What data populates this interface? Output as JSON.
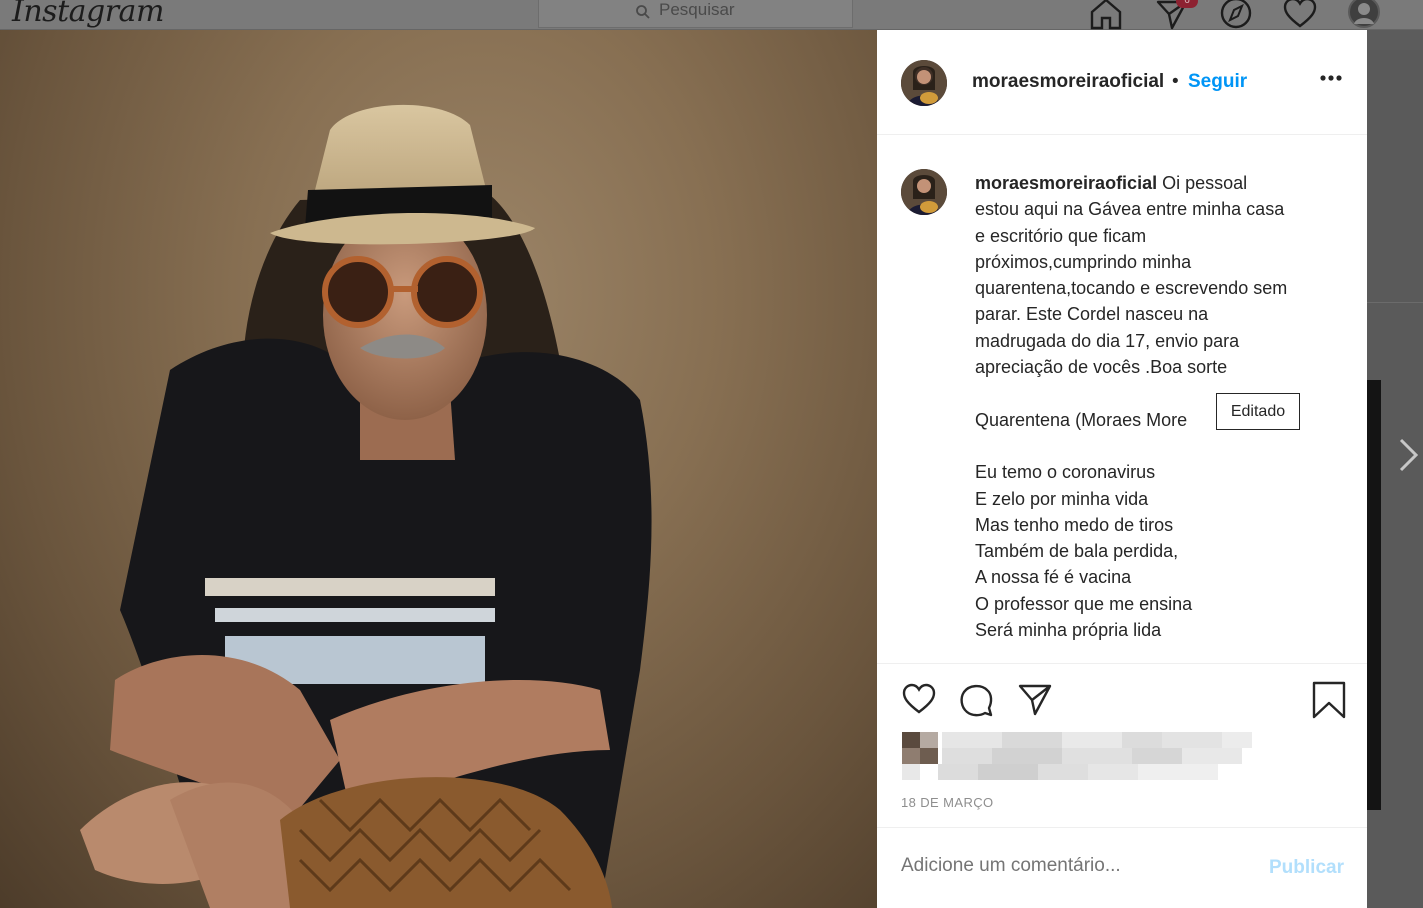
{
  "app": {
    "logo": "Instagram"
  },
  "topbar": {
    "search_placeholder": "Pesquisar",
    "notification_count": "6",
    "icons": [
      "home-icon",
      "direct-icon",
      "explore-icon",
      "activity-heart-icon",
      "profile-avatar"
    ]
  },
  "post": {
    "username": "moraesmoreiraoficial",
    "separator": "•",
    "follow_label": "Seguir",
    "more_icon": "more-options-icon",
    "caption_lines": [
      "Oi pessoal",
      "estou aqui na Gávea entre minha casa",
      "e escritório que ficam",
      "próximos,cumprindo minha",
      "quarentena,tocando e escrevendo sem",
      "parar. Este Cordel nasceu na",
      "madrugada do dia 17, envio para",
      "apreciação de vocês .Boa sorte",
      "",
      "Quarentena (Moraes More",
      "",
      "Eu temo o coronavirus",
      "E zelo por minha vida",
      "Mas tenho medo de tiros",
      "Também de bala perdida,",
      "A nossa fé é vacina",
      "O professor que me ensina",
      "Será minha própria lida"
    ],
    "edited_tooltip": "Editado",
    "date": "18 DE MARÇO",
    "actions": [
      "like-heart-icon",
      "comment-icon",
      "share-icon",
      "save-bookmark-icon"
    ],
    "comment_placeholder": "Adicione um comentário...",
    "publish_label": "Publicar"
  },
  "colors": {
    "link_blue": "#0095f6",
    "publish_disabled": "#b2dffc",
    "text": "#262626",
    "muted": "#8e8e8e"
  }
}
